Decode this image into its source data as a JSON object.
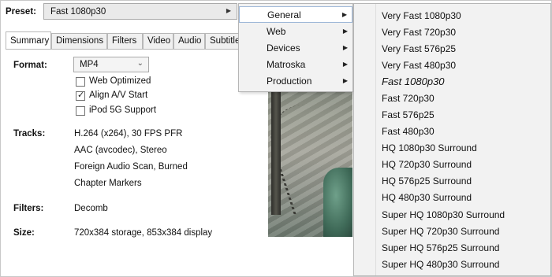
{
  "preset": {
    "label": "Preset:",
    "value": "Fast 1080p30"
  },
  "tabs": [
    {
      "label": "Summary"
    },
    {
      "label": "Dimensions"
    },
    {
      "label": "Filters"
    },
    {
      "label": "Video"
    },
    {
      "label": "Audio"
    },
    {
      "label": "Subtitle"
    }
  ],
  "summary": {
    "format_label": "Format:",
    "format_value": "MP4",
    "options": [
      {
        "label": "Web Optimized",
        "checked": false
      },
      {
        "label": "Align A/V Start",
        "checked": true
      },
      {
        "label": "iPod 5G Support",
        "checked": false
      }
    ],
    "tracks_label": "Tracks:",
    "tracks": [
      "H.264 (x264), 30 FPS PFR",
      "AAC (avcodec), Stereo",
      "Foreign Audio Scan, Burned",
      "Chapter Markers"
    ],
    "filters_label": "Filters:",
    "filters_value": "Decomb",
    "size_label": "Size:",
    "size_value": "720x384 storage, 853x384 display"
  },
  "preset_menu": {
    "categories": [
      {
        "label": "General",
        "selected": true
      },
      {
        "label": "Web",
        "selected": false
      },
      {
        "label": "Devices",
        "selected": false
      },
      {
        "label": "Matroska",
        "selected": false
      },
      {
        "label": "Production",
        "selected": false
      }
    ],
    "general_presets": [
      "Very Fast 1080p30",
      "Very Fast 720p30",
      "Very Fast 576p25",
      "Very Fast 480p30",
      "Fast 1080p30",
      "Fast 720p30",
      "Fast 576p25",
      "Fast 480p30",
      "HQ 1080p30 Surround",
      "HQ 720p30 Surround",
      "HQ 576p25 Surround",
      "HQ 480p30 Surround",
      "Super HQ 1080p30 Surround",
      "Super HQ 720p30 Surround",
      "Super HQ 576p25 Surround",
      "Super HQ 480p30 Surround"
    ],
    "default_preset": "Fast 1080p30"
  },
  "icons": {
    "submenu": "chevron-right-icon",
    "dropdown": "chevron-down-icon",
    "check": "check-icon"
  },
  "colors": {
    "menu_bg": "#f2f2f2",
    "selected_border": "#9fb8d8"
  }
}
